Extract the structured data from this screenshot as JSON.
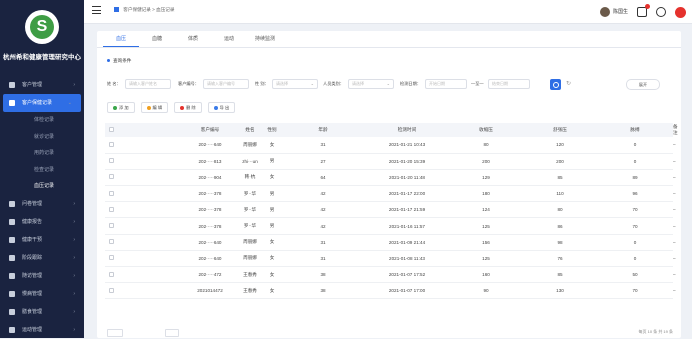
{
  "sidebar": {
    "org_name": "杭州希和健康管理研究中心",
    "items": [
      {
        "label": "客户管理",
        "icon": "user-icon"
      },
      {
        "label": "客户保健记录",
        "icon": "record-icon",
        "active": true
      },
      {
        "label": "问卷管理",
        "icon": "questionnaire-icon"
      },
      {
        "label": "健康报告",
        "icon": "report-icon"
      },
      {
        "label": "健康干预",
        "icon": "intervention-icon"
      },
      {
        "label": "阶段跟踪",
        "icon": "tracking-icon"
      },
      {
        "label": "随访管理",
        "icon": "followup-icon"
      },
      {
        "label": "慢病管理",
        "icon": "chronic-icon"
      },
      {
        "label": "膳食管理",
        "icon": "diet-icon"
      },
      {
        "label": "运动管理",
        "icon": "exercise-icon"
      }
    ],
    "sub_items": [
      "体检记录",
      "就诊记录",
      "用药记录",
      "检查记录",
      "血压记录"
    ],
    "selected_sub": "血压记录"
  },
  "topbar": {
    "breadcrumb": [
      "客户保健记录",
      "血压记录"
    ],
    "breadcrumb_sep": ">",
    "user": "陈国生",
    "message_badge": "1"
  },
  "tabs": [
    "血压",
    "血糖",
    "体质",
    "运动",
    "持续监测"
  ],
  "section_title": "查询条件",
  "filters": {
    "name_label": "姓    名：",
    "name_ph": "请输入客户姓名",
    "id_label": "客户编号：",
    "id_ph": "请输入客户编号",
    "sex_label": "性    别：",
    "sex_ph": "请选择",
    "staff_label": "人员类别：",
    "staff_ph": "请选择",
    "date_label": "检测日期：",
    "start_ph": "开始日期",
    "range_sep": "—至—",
    "end_ph": "结束日期",
    "expand_label": "展开"
  },
  "actions": [
    "添 加",
    "编 辑",
    "删 除",
    "导 出"
  ],
  "action_colors": [
    "#3aa64b",
    "#f0a020",
    "#e5322d",
    "#3a7be8"
  ],
  "columns": [
    "客户编号",
    "姓名",
    "性别",
    "年龄",
    "检测时间",
    "收缩压",
    "舒张压",
    "脉搏",
    "备注"
  ],
  "rows": [
    {
      "id": "202·····640",
      "name": "周丽娜",
      "sex": "女",
      "age": "31",
      "time": "2021-01-21 10:43",
      "sys": "80",
      "dia": "120",
      "pulse": "0",
      "note": "–",
      "sys_red": true,
      "dia_red": true,
      "pulse_red": true
    },
    {
      "id": "202·····813",
      "name": "zhi···un",
      "sex": "男",
      "age": "27",
      "time": "2021-01-20 15:39",
      "sys": "200",
      "dia": "200",
      "pulse": "0",
      "note": "–",
      "sys_red": true,
      "dia_red": true,
      "pulse_red": true
    },
    {
      "id": "202·····904",
      "name": "韩·杭",
      "sex": "女",
      "age": "64",
      "time": "2021-01-20 11:48",
      "sys": "129",
      "dia": "85",
      "pulse": "89",
      "note": "–"
    },
    {
      "id": "202·····378",
      "name": "罗··华",
      "sex": "男",
      "age": "42",
      "time": "2021-01-17 22:00",
      "sys": "180",
      "dia": "110",
      "pulse": "96",
      "note": "–",
      "sys_red": true,
      "dia_red": true
    },
    {
      "id": "202·····378",
      "name": "罗··华",
      "sex": "男",
      "age": "42",
      "time": "2021-01-17 21:59",
      "sys": "124",
      "dia": "80",
      "pulse": "70",
      "note": "–"
    },
    {
      "id": "202·····378",
      "name": "罗··华",
      "sex": "男",
      "age": "42",
      "time": "2021-01-16 11:57",
      "sys": "125",
      "dia": "86",
      "pulse": "70",
      "note": "–"
    },
    {
      "id": "202·····640",
      "name": "周丽娜",
      "sex": "女",
      "age": "31",
      "time": "2021-01-09 21:44",
      "sys": "156",
      "dia": "98",
      "pulse": "0",
      "note": "–",
      "sys_red": true,
      "dia_red": true,
      "pulse_red": true
    },
    {
      "id": "202·····640",
      "name": "周丽娜",
      "sex": "女",
      "age": "31",
      "time": "2021-01-08 11:43",
      "sys": "125",
      "dia": "76",
      "pulse": "0",
      "note": "–",
      "pulse_red": true
    },
    {
      "id": "202·····472",
      "name": "王春秀",
      "sex": "女",
      "age": "38",
      "time": "2021-01-07 17:52",
      "sys": "160",
      "dia": "85",
      "pulse": "50",
      "note": "–",
      "sys_red": true,
      "pulse_red": true
    },
    {
      "id": "2021014472",
      "name": "王春秀",
      "sex": "女",
      "age": "38",
      "time": "2021-01-07 17:00",
      "sys": "90",
      "dia": "130",
      "pulse": "70",
      "note": "–",
      "dia_red": true
    }
  ],
  "pager_text": "每页 10 条 共 19 条"
}
